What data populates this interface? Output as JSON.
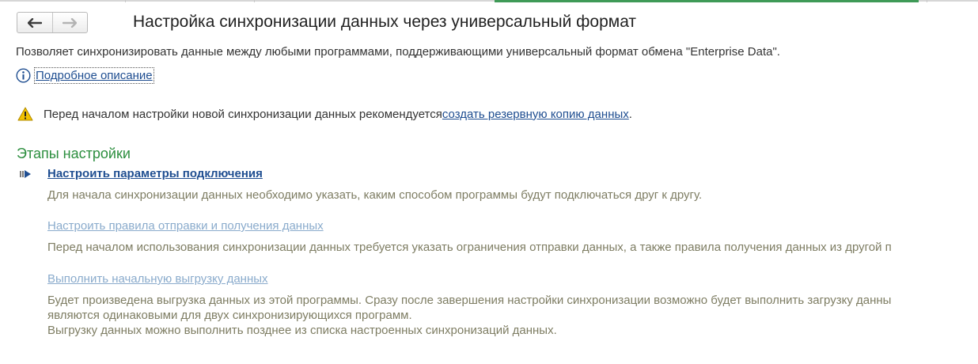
{
  "header": {
    "title": "Настройка синхронизации данных через универсальный формат",
    "back_icon": "arrow-left-icon",
    "forward_icon": "arrow-right-icon"
  },
  "description": "Позволяет синхронизировать данные между любыми программами, поддерживающими универсальный формат обмена \"Enterprise Data\".",
  "info": {
    "icon": "info-icon",
    "link_label": "Подробное описание"
  },
  "warning": {
    "icon": "warning-icon",
    "text_before": "Перед началом настройки новой синхронизации данных рекомендуется ",
    "link_label": "создать резервную копию данных",
    "text_after": "."
  },
  "stages": {
    "title": "Этапы настройки",
    "current_icon": "current-step-arrow-icon",
    "steps": [
      {
        "label": "Настроить параметры подключения",
        "state": "active",
        "description": [
          "Для начала синхронизации данных необходимо указать, каким способом программы будут подключаться друг к другу."
        ]
      },
      {
        "label": "Настроить правила отправки и получения данных",
        "state": "inactive",
        "description": [
          "Перед началом использования синхронизации данных требуется указать ограничения отправки данных, а также правила получения данных из другой п"
        ]
      },
      {
        "label": "Выполнить начальную выгрузку данных",
        "state": "inactive",
        "description": [
          "Будет произведена выгрузка данных из этой программы. Сразу после завершения настройки синхронизации возможно будет выполнить загрузку данны",
          "являются одинаковыми для двух синхронизирующихся программ.",
          "Выгрузку данных можно выполнить позднее из списка настроенных синхронизаций данных."
        ]
      }
    ]
  },
  "colors": {
    "accent_green": "#2b8e3e",
    "link_blue": "#1f4e91",
    "disabled_link": "#8aabcc",
    "hint_text": "#7e7d63",
    "warning_yellow": "#f2c200"
  }
}
